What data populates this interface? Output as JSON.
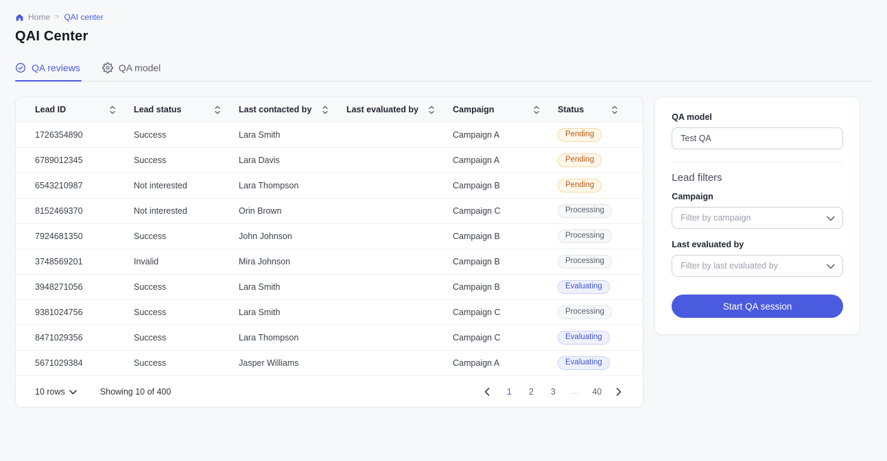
{
  "accent_color": "#4a5bdf",
  "breadcrumb": {
    "home": "Home",
    "separator": ">",
    "current": "QAI center"
  },
  "page_title": "QAI Center",
  "tabs": [
    {
      "label": "QA reviews",
      "icon": "check-circle",
      "active": true
    },
    {
      "label": "QA model",
      "icon": "gear",
      "active": false
    }
  ],
  "table": {
    "columns": [
      "Lead ID",
      "Lead status",
      "Last contacted by",
      "Last evaluated by",
      "Campaign",
      "Status"
    ],
    "row_keys": [
      "lead_id",
      "lead_status",
      "last_contacted_by",
      "last_evaluated_by",
      "campaign"
    ],
    "rows": [
      {
        "lead_id": "1726354890",
        "lead_status": "Success",
        "last_contacted_by": "Lara Smith",
        "last_evaluated_by": "",
        "campaign": "Campaign A",
        "status": "Pending"
      },
      {
        "lead_id": "6789012345",
        "lead_status": "Success",
        "last_contacted_by": "Lara Davis",
        "last_evaluated_by": "",
        "campaign": "Campaign A",
        "status": "Pending"
      },
      {
        "lead_id": "6543210987",
        "lead_status": "Not interested",
        "last_contacted_by": "Lara Thompson",
        "last_evaluated_by": "",
        "campaign": "Campaign B",
        "status": "Pending"
      },
      {
        "lead_id": "8152469370",
        "lead_status": "Not interested",
        "last_contacted_by": "Orin Brown",
        "last_evaluated_by": "",
        "campaign": "Campaign C",
        "status": "Processing"
      },
      {
        "lead_id": "7924681350",
        "lead_status": "Success",
        "last_contacted_by": "John Johnson",
        "last_evaluated_by": "",
        "campaign": "Campaign B",
        "status": "Processing"
      },
      {
        "lead_id": "3748569201",
        "lead_status": "Invalid",
        "last_contacted_by": "Mira Johnson",
        "last_evaluated_by": "",
        "campaign": "Campaign B",
        "status": "Processing"
      },
      {
        "lead_id": "3948271056",
        "lead_status": "Success",
        "last_contacted_by": "Lara Smith",
        "last_evaluated_by": "",
        "campaign": "Campaign B",
        "status": "Evaluating"
      },
      {
        "lead_id": "9381024756",
        "lead_status": "Success",
        "last_contacted_by": "Lara Smith",
        "last_evaluated_by": "",
        "campaign": "Campaign C",
        "status": "Processing"
      },
      {
        "lead_id": "8471029356",
        "lead_status": "Success",
        "last_contacted_by": "Lara Thompson",
        "last_evaluated_by": "",
        "campaign": "Campaign C",
        "status": "Evaluating"
      },
      {
        "lead_id": "5671029384",
        "lead_status": "Success",
        "last_contacted_by": "Jasper Williams",
        "last_evaluated_by": "",
        "campaign": "Campaign A",
        "status": "Evaluating"
      }
    ],
    "status_styles": {
      "Pending": {
        "color": "#c05717",
        "bg": "#fdf8ea",
        "border": "#f3d9a0"
      },
      "Processing": {
        "color": "#555b67",
        "bg": "#f7f8f9",
        "border": "#e1e4e8"
      },
      "Evaluating": {
        "color": "#4353cf",
        "bg": "#eef1fd",
        "border": "#c9d2f8"
      }
    },
    "footer": {
      "rows_selector": "10 rows",
      "showing": "Showing 10 of 400",
      "pages": [
        "1",
        "2",
        "3",
        "…",
        "40"
      ],
      "active_page": "1"
    }
  },
  "panel": {
    "qa_model_label": "QA model",
    "qa_model_value": "Test QA",
    "filters_title": "Lead filters",
    "campaign_label": "Campaign",
    "campaign_placeholder": "Filter by campaign",
    "evaluated_label": "Last evaluated by",
    "evaluated_placeholder": "Filter by last evaluated by",
    "start_button": "Start QA session"
  }
}
